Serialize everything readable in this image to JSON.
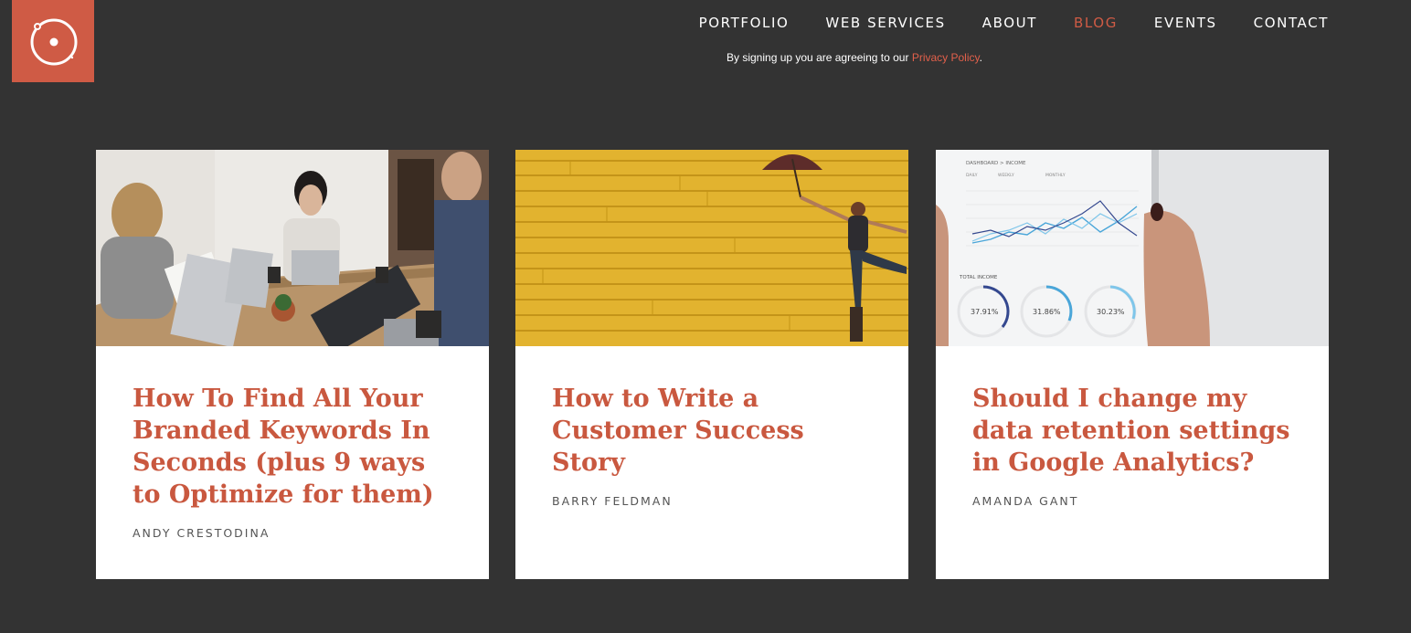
{
  "header": {
    "logo": {
      "name": "brand-logo"
    },
    "nav": [
      {
        "label": "PORTFOLIO",
        "active": false
      },
      {
        "label": "WEB SERVICES",
        "active": false
      },
      {
        "label": "ABOUT",
        "active": false
      },
      {
        "label": "BLOG",
        "active": true
      },
      {
        "label": "EVENTS",
        "active": false
      },
      {
        "label": "CONTACT",
        "active": false
      }
    ],
    "signup_text": "By signing up you are agreeing to our ",
    "privacy_link": "Privacy Policy",
    "signup_suffix": "."
  },
  "posts": [
    {
      "title": "How To Find All Your Branded Keywords In Seconds (plus 9 ways to Optimize for them)",
      "author": "ANDY CRESTODINA",
      "image": "meeting-photo"
    },
    {
      "title": "How to Write a Customer Success Story",
      "author": "BARRY FELDMAN",
      "image": "umbrella-wall-photo"
    },
    {
      "title": "Should I change my data retention settings in Google Analytics?",
      "author": "AMANDA GANT",
      "image": "analytics-tablet-photo"
    }
  ],
  "tablet": {
    "header": "DASHBOARD > INCOME",
    "tabs": [
      "DAILY",
      "WEEKLY",
      "MONTHLY"
    ],
    "total_label": "TOTAL INCOME",
    "percents": [
      "37.91%",
      "31.86%",
      "30.23%"
    ]
  },
  "colors": {
    "accent": "#cf5b45",
    "background": "#333333",
    "title": "#c9583f"
  }
}
